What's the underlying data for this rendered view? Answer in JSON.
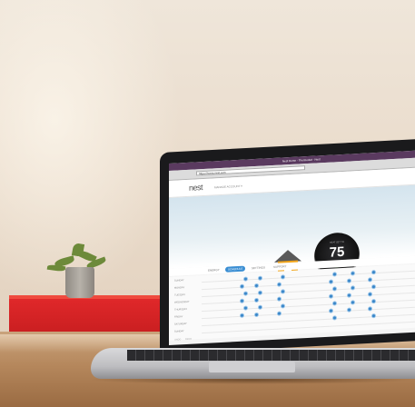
{
  "browser": {
    "os_menu_title": "Nest Home - Thermostat - Nest",
    "url": "https://home.nest.com"
  },
  "app": {
    "logo": "nest",
    "account_text": "MANAGE ACCOUNT ▾"
  },
  "home": {
    "house_label": "MAIN HOUSE",
    "thermostat_label": "LIVING ROOM",
    "thermostat_heat_label": "HEAT SET TO",
    "target_temperature": "75"
  },
  "tabs": [
    {
      "label": "ENERGY"
    },
    {
      "label": "SCHEDULE"
    },
    {
      "label": "SETTINGS"
    },
    {
      "label": "SUPPORT"
    }
  ],
  "schedule": {
    "days": [
      "SUNDAY",
      "MONDAY",
      "TUESDAY",
      "WEDNESDAY",
      "THURSDAY",
      "FRIDAY",
      "SATURDAY",
      "SUNDAY"
    ],
    "footer_left": "UNDO",
    "footer_right": "REDO"
  },
  "colors": {
    "tab_active": "#3a8ed3",
    "schedule_dot": "#3a86c8",
    "shelf": "#d92426"
  }
}
